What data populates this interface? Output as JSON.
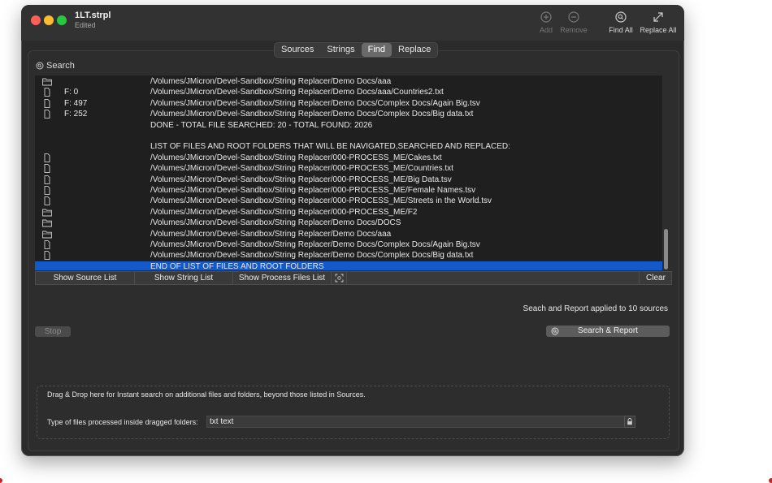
{
  "window": {
    "title": "1LT.strpl",
    "subtitle": "Edited"
  },
  "toolbar": {
    "add": "Add",
    "remove": "Remove",
    "find_all": "Find All",
    "replace_all": "Replace All"
  },
  "tabs": [
    "Sources",
    "Strings",
    "Find",
    "Replace"
  ],
  "active_tab": "Find",
  "search_label": "Search",
  "log_rows": [
    {
      "icon": "folder",
      "count": "",
      "path": "/Volumes/JMicron/Devel-Sandbox/String Replacer/Demo Docs/aaa"
    },
    {
      "icon": "file",
      "count": "F: 0",
      "path": "/Volumes/JMicron/Devel-Sandbox/String Replacer/Demo Docs/aaa/Countries2.txt"
    },
    {
      "icon": "file",
      "count": "F: 497",
      "path": "/Volumes/JMicron/Devel-Sandbox/String Replacer/Demo Docs/Complex Docs/Again Big.tsv"
    },
    {
      "icon": "file",
      "count": "F: 252",
      "path": "/Volumes/JMicron/Devel-Sandbox/String Replacer/Demo Docs/Complex Docs/Big data.txt"
    },
    {
      "icon": "",
      "count": "",
      "path": "DONE - TOTAL FILE SEARCHED: 20 - TOTAL FOUND: 2026"
    },
    {
      "icon": "",
      "count": "",
      "path": ""
    },
    {
      "icon": "",
      "count": "",
      "path": "LIST OF FILES AND ROOT FOLDERS THAT WILL BE NAVIGATED,SEARCHED AND REPLACED:"
    },
    {
      "icon": "file",
      "count": "",
      "path": "/Volumes/JMicron/Devel-Sandbox/String Replacer/000-PROCESS_ME/Cakes.txt"
    },
    {
      "icon": "file",
      "count": "",
      "path": "/Volumes/JMicron/Devel-Sandbox/String Replacer/000-PROCESS_ME/Countries.txt"
    },
    {
      "icon": "file",
      "count": "",
      "path": "/Volumes/JMicron/Devel-Sandbox/String Replacer/000-PROCESS_ME/Big Data.tsv"
    },
    {
      "icon": "file",
      "count": "",
      "path": "/Volumes/JMicron/Devel-Sandbox/String Replacer/000-PROCESS_ME/Female Names.tsv"
    },
    {
      "icon": "file",
      "count": "",
      "path": "/Volumes/JMicron/Devel-Sandbox/String Replacer/000-PROCESS_ME/Streets in the World.tsv"
    },
    {
      "icon": "folder",
      "count": "",
      "path": "/Volumes/JMicron/Devel-Sandbox/String Replacer/000-PROCESS_ME/F2"
    },
    {
      "icon": "folder",
      "count": "",
      "path": "/Volumes/JMicron/Devel-Sandbox/String Replacer/Demo Docs/DOCS"
    },
    {
      "icon": "folder",
      "count": "",
      "path": "/Volumes/JMicron/Devel-Sandbox/String Replacer/Demo Docs/aaa"
    },
    {
      "icon": "file",
      "count": "",
      "path": "/Volumes/JMicron/Devel-Sandbox/String Replacer/Demo Docs/Complex Docs/Again Big.tsv"
    },
    {
      "icon": "file",
      "count": "",
      "path": "/Volumes/JMicron/Devel-Sandbox/String Replacer/Demo Docs/Complex Docs/Big data.txt"
    },
    {
      "icon": "",
      "count": "",
      "path": "END OF LIST OF FILES AND ROOT FOLDERS",
      "selected": true
    }
  ],
  "buttons": {
    "show_source_list": "Show Source List",
    "show_string_list": "Show String List",
    "show_process_files_list": "Show Process Files List",
    "clear": "Clear"
  },
  "applied_text": "Seach and Report applied to  10 sources",
  "stop": "Stop",
  "search_report": "Search & Report",
  "drop_text": "Drag & Drop here for Instant search on additional files and folders, beyond those listed in Sources.",
  "type_label": "Type of files processed inside dragged folders:",
  "type_value": "txt text"
}
